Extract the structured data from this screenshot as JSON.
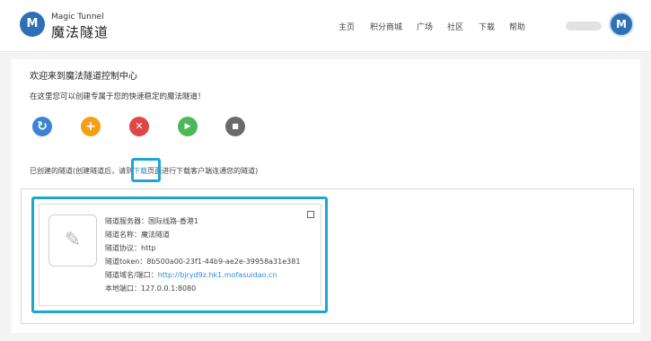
{
  "header": {
    "logo_glyph": "M",
    "brand_en": "Magic Tunnel",
    "brand_cn": "魔法隧道",
    "nav": [
      "主页",
      "积分商城",
      "广场",
      "社区",
      "下载",
      "帮助"
    ],
    "avatar_glyph": "M"
  },
  "main": {
    "title": "欢迎来到魔法隧道控制中心",
    "subtitle": "在这里您可以创建专属于您的快速稳定的魔法隧道！",
    "actions": [
      {
        "name": "refresh-icon",
        "glyph": "↻",
        "color": "#3b83d6"
      },
      {
        "name": "add-icon",
        "glyph": "+",
        "color": "#f4a017"
      },
      {
        "name": "delete-icon",
        "glyph": "✕",
        "color": "#e04646"
      },
      {
        "name": "start-icon",
        "glyph": "▶",
        "color": "#4cb957"
      },
      {
        "name": "stop-icon",
        "glyph": "■",
        "color": "#6a6a6a"
      }
    ],
    "tunnels_prefix": "已创建的隧道(创建隧道后，请到",
    "tunnels_link": "下载",
    "tunnels_suffix": "页面进行下载客户端连通您的隧道)"
  },
  "tunnel": {
    "thumb_glyph": "✎",
    "server": "隧道服务器：国际线路-香港1",
    "name": "隧道名称：魔法隧道",
    "protocol": "隧道协议：http",
    "token": "隧道token：8b500a00-23f1-44b9-ae2e-39958a31e381",
    "domain_label": "隧道域名/端口：",
    "domain_value": "http://bjryd9z.hk1.mofasuidao.cn",
    "local": "本地端口：127.0.0.1:8080"
  }
}
